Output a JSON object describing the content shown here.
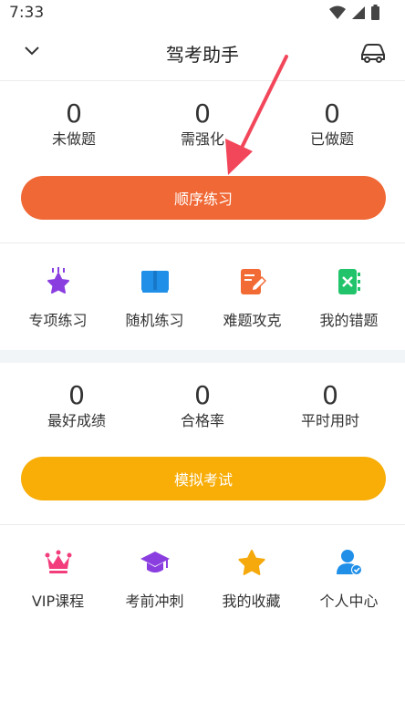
{
  "status_bar": {
    "time": "7:33"
  },
  "header": {
    "title": "驾考助手"
  },
  "practice_stats": [
    {
      "value": "0",
      "label": "未做题"
    },
    {
      "value": "0",
      "label": "需强化"
    },
    {
      "value": "0",
      "label": "已做题"
    }
  ],
  "practice_button": {
    "label": "顺序练习"
  },
  "practice_grid": [
    {
      "label": "专项练习",
      "icon": "star-icon"
    },
    {
      "label": "随机练习",
      "icon": "book-icon"
    },
    {
      "label": "难题攻克",
      "icon": "edit-icon"
    },
    {
      "label": "我的错题",
      "icon": "wrong-icon"
    }
  ],
  "exam_stats": [
    {
      "value": "0",
      "label": "最好成绩"
    },
    {
      "value": "0",
      "label": "合格率"
    },
    {
      "value": "0",
      "label": "平时用时"
    }
  ],
  "exam_button": {
    "label": "模拟考试"
  },
  "more_grid": [
    {
      "label": "VIP课程",
      "icon": "crown-icon"
    },
    {
      "label": "考前冲刺",
      "icon": "graduation-cap-icon"
    },
    {
      "label": "我的收藏",
      "icon": "star-icon"
    },
    {
      "label": "个人中心",
      "icon": "user-icon"
    }
  ],
  "colors": {
    "orange_button": "#f06835",
    "yellow_button": "#f8ad07",
    "purple": "#8a3ee0",
    "blue": "#1f8fe8",
    "orange_icon": "#f26a34",
    "green": "#21c46b",
    "pink": "#f23c7c",
    "gold": "#f5a90c",
    "annotation_arrow": "#f2475a"
  }
}
